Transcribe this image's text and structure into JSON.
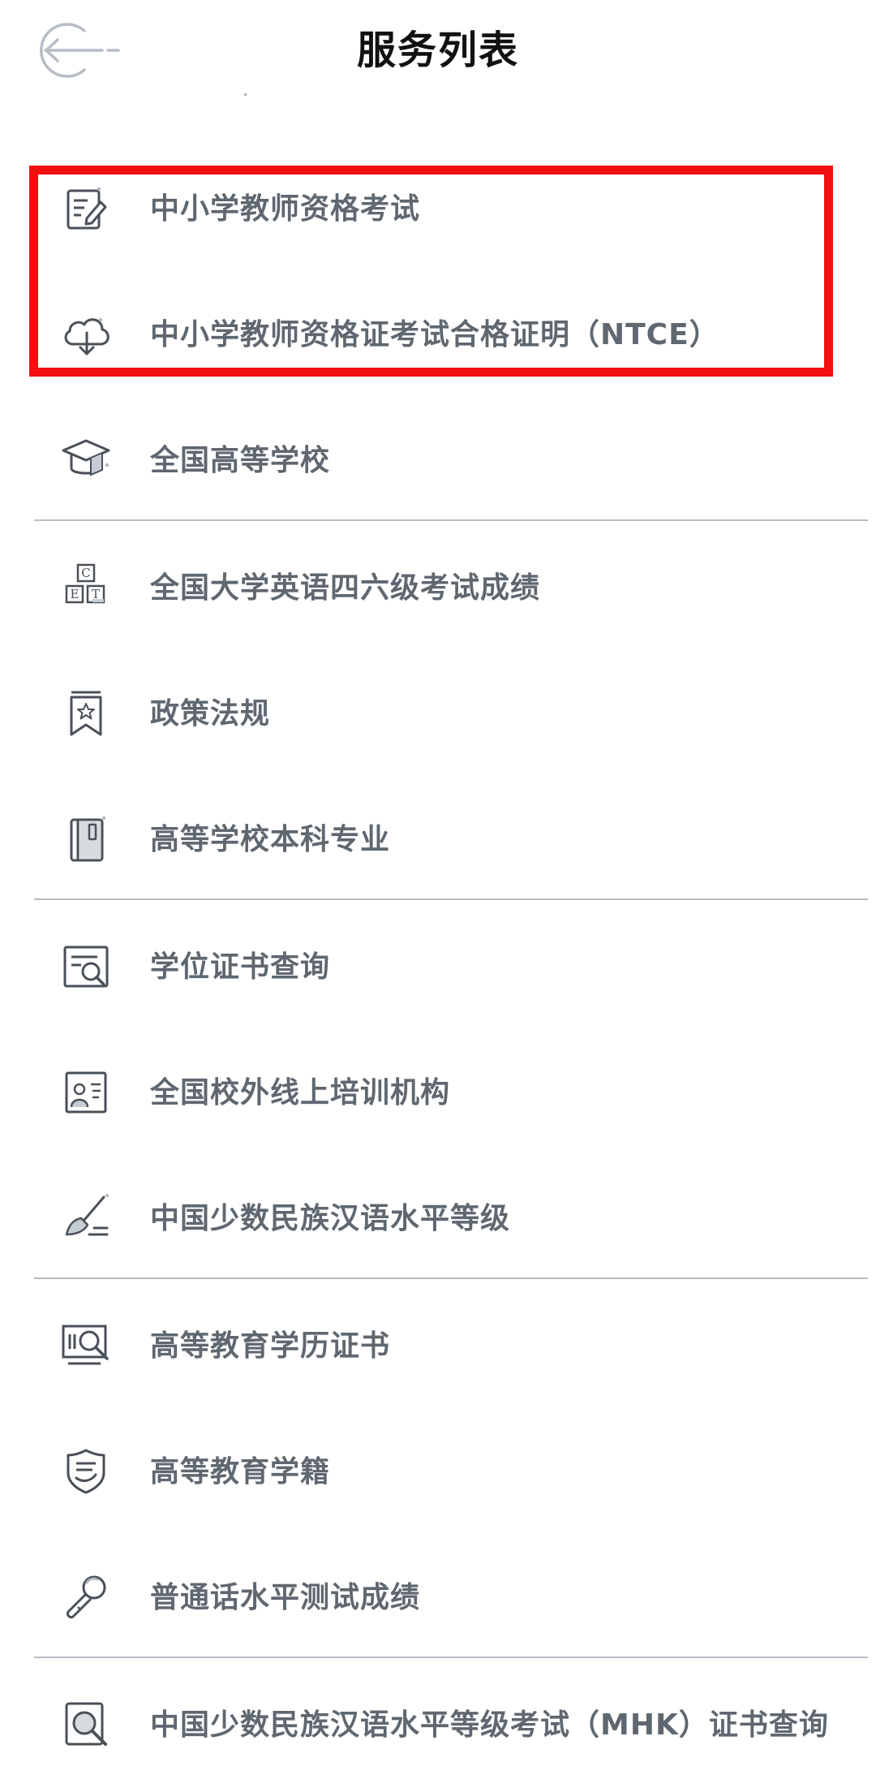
{
  "header": {
    "title": "服务列表",
    "back_icon": "arrow-left-circle-icon"
  },
  "services": [
    {
      "label": "中小学教师资格考试",
      "icon": "document-edit-icon"
    },
    {
      "label": "中小学教师资格证考试合格证明（NTCE）",
      "icon": "cloud-download-icon"
    },
    {
      "label": "全国高等学校",
      "icon": "graduation-cap-icon"
    },
    {
      "label": "全国大学英语四六级考试成绩",
      "icon": "letter-blocks-icon"
    },
    {
      "label": "政策法规",
      "icon": "bookmark-star-icon"
    },
    {
      "label": "高等学校本科专业",
      "icon": "book-icon"
    },
    {
      "label": "学位证书查询",
      "icon": "certificate-search-icon"
    },
    {
      "label": "全国校外线上培训机构",
      "icon": "person-card-icon"
    },
    {
      "label": "中国少数民族汉语水平等级",
      "icon": "paint-brush-icon"
    },
    {
      "label": "高等教育学历证书",
      "icon": "monitor-search-icon"
    },
    {
      "label": "高等教育学籍",
      "icon": "shield-list-icon"
    },
    {
      "label": "普通话水平测试成绩",
      "icon": "microphone-icon"
    },
    {
      "label": "中国少数民族汉语水平等级考试（MHK）证书查询",
      "icon": "magnifier-icon"
    }
  ],
  "colors": {
    "highlight": "#f21010",
    "label": "#5f6770",
    "icon_stroke": "#4a5058",
    "divider": "#b5bcc4"
  }
}
